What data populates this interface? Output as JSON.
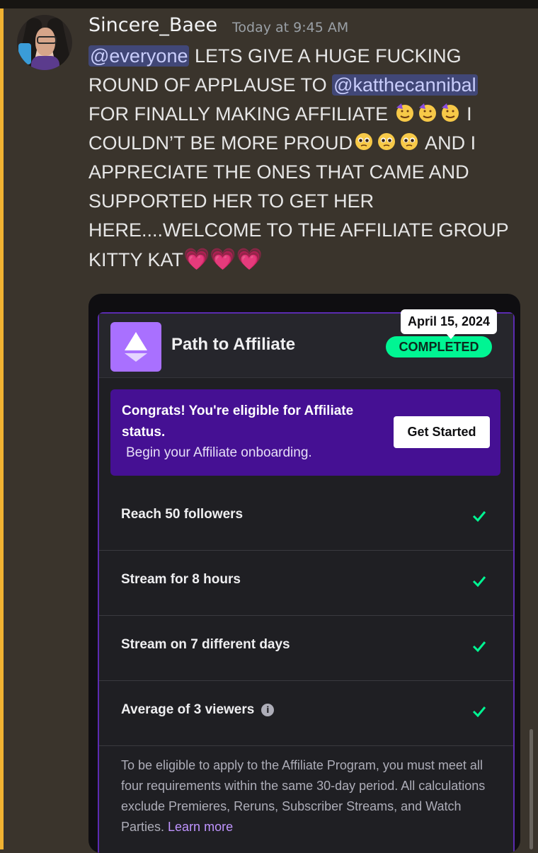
{
  "post": {
    "username": "Sincere_Baee",
    "timestamp": "Today at 9:45 AM",
    "mention_everyone": "@everyone",
    "text1": " LETS GIVE A HUGE FUCKING ROUND OF APPLAUSE TO ",
    "mention_user": "@katthecannibal",
    "text2": " FOR FINALLY MAKING AFFILIATE ",
    "text3": " I COULDN’T BE MORE PROUD",
    "text4": " AND I APPRECIATE THE ONES THAT CAME AND SUPPORTED HER TO GET HER HERE....WELCOME TO THE AFFILIATE GROUP KITTY KAT",
    "hearts": "💗💗💗",
    "accent_color": "#f0b232"
  },
  "embed": {
    "title": "Path to Affiliate",
    "date_tooltip": "April 15, 2024",
    "status_badge": "COMPLETED",
    "congrats_title": "Congrats! You're eligible for Affiliate status.",
    "congrats_sub": "Begin your Affiliate onboarding.",
    "cta_label": "Get Started",
    "requirements": [
      {
        "label": "Reach 50 followers",
        "done": true
      },
      {
        "label": "Stream for 8 hours",
        "done": true
      },
      {
        "label": "Stream on 7 different days",
        "done": true
      },
      {
        "label": "Average of 3 viewers",
        "done": true,
        "info_icon": "info-icon"
      }
    ],
    "footer_text": "To be eligible to apply to the Affiliate Program, you must meet all four requirements within the same 30-day period. All calculations exclude Premieres, Reruns, Subscriber Streams, and Watch Parties. ",
    "learn_more": "Learn more"
  }
}
